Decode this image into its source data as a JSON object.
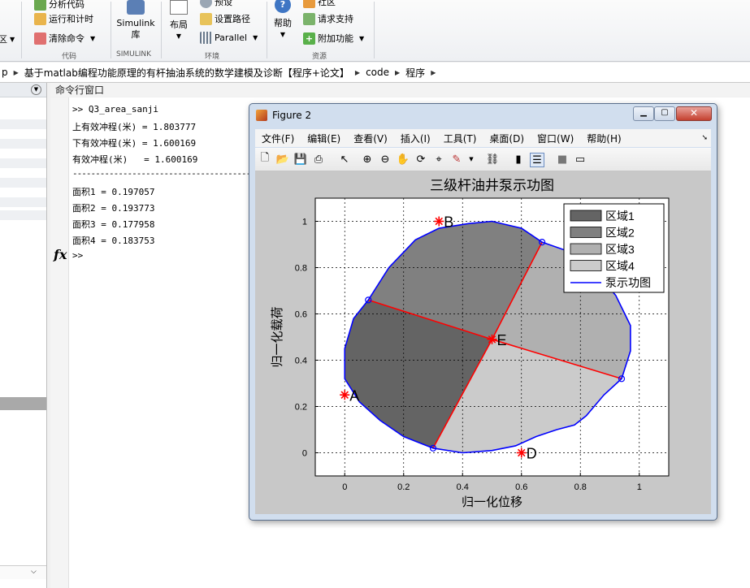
{
  "ribbon": {
    "code_group": {
      "label": "代码",
      "items": [
        "分析代码",
        "运行和计时",
        "清除命令"
      ]
    },
    "left_cut_label": "区",
    "simulink_group": {
      "label": "SIMULINK",
      "button": [
        "Simulink",
        "库"
      ]
    },
    "env_group": {
      "label": "环境",
      "layout_button": "布局",
      "items": [
        "预设",
        "设置路径",
        "Parallel"
      ]
    },
    "resource_group": {
      "label": "资源",
      "help_button": "帮助",
      "items": [
        "社区",
        "请求支持",
        "附加功能"
      ]
    }
  },
  "address": {
    "crumbs": [
      "p",
      "基于matlab编程功能原理的有杆抽油系统的数学建模及诊断【程序+论文】",
      "code",
      "程序"
    ]
  },
  "command_window": {
    "title": "命令行窗口",
    "lines": [
      ">> Q3_area_sanji",
      "上有效冲程(米) = 1.803777",
      "下有效冲程(米) = 1.600169",
      "有效冲程(米)   = 1.600169",
      "------------------------------------------------",
      "面积1 = 0.197057",
      "面积2 = 0.193773",
      "面积3 = 0.177958",
      "面积4 = 0.183753",
      ">>"
    ],
    "fx_label": "fx"
  },
  "figure": {
    "title": "Figure 2",
    "menu": [
      "文件(F)",
      "编辑(E)",
      "查看(V)",
      "插入(I)",
      "工具(T)",
      "桌面(D)",
      "窗口(W)",
      "帮助(H)"
    ]
  },
  "chart_data": {
    "type": "area",
    "title": "三级杆油井泵示功图",
    "xlabel": "归一化位移",
    "ylabel": "归一化载荷",
    "xlim": [
      -0.1,
      1.1
    ],
    "ylim": [
      -0.1,
      1.1
    ],
    "xticks": [
      "0",
      "0.2",
      "0.4",
      "0.6",
      "0.8",
      "1"
    ],
    "yticks": [
      "0",
      "0.2",
      "0.4",
      "0.6",
      "0.8",
      "1"
    ],
    "grid": true,
    "legend_position": "top-right",
    "legend": [
      "区域1",
      "区域2",
      "区域3",
      "区域4",
      "泵示功图"
    ],
    "colors": {
      "region1": "#646464",
      "region2": "#808080",
      "region3": "#b0b0b0",
      "region4": "#cbcbcb",
      "curve": "#0000ff",
      "line": "#ff0000",
      "marker": "#ff0000"
    },
    "center": [
      0.5,
      0.49
    ],
    "circle_points": [
      [
        0.08,
        0.66
      ],
      [
        0.67,
        0.91
      ],
      [
        0.94,
        0.32
      ],
      [
        0.3,
        0.02
      ]
    ],
    "regions": [
      {
        "name": "区域1",
        "points": [
          [
            0.5,
            0.49
          ],
          [
            0.08,
            0.66
          ],
          [
            0.03,
            0.58
          ],
          [
            0.0,
            0.45
          ],
          [
            0.0,
            0.32
          ],
          [
            0.05,
            0.22
          ],
          [
            0.12,
            0.14
          ],
          [
            0.2,
            0.07
          ],
          [
            0.3,
            0.02
          ]
        ]
      },
      {
        "name": "区域2",
        "points": [
          [
            0.5,
            0.49
          ],
          [
            0.08,
            0.66
          ],
          [
            0.15,
            0.8
          ],
          [
            0.24,
            0.92
          ],
          [
            0.32,
            0.97
          ],
          [
            0.42,
            0.99
          ],
          [
            0.5,
            1.0
          ],
          [
            0.6,
            0.97
          ],
          [
            0.67,
            0.91
          ]
        ]
      },
      {
        "name": "区域3",
        "points": [
          [
            0.5,
            0.49
          ],
          [
            0.67,
            0.91
          ],
          [
            0.76,
            0.87
          ],
          [
            0.84,
            0.8
          ],
          [
            0.92,
            0.68
          ],
          [
            0.97,
            0.55
          ],
          [
            0.97,
            0.44
          ],
          [
            0.94,
            0.32
          ]
        ]
      },
      {
        "name": "区域4",
        "points": [
          [
            0.5,
            0.49
          ],
          [
            0.94,
            0.32
          ],
          [
            0.88,
            0.25
          ],
          [
            0.82,
            0.16
          ],
          [
            0.78,
            0.12
          ],
          [
            0.72,
            0.1
          ],
          [
            0.65,
            0.07
          ],
          [
            0.58,
            0.03
          ],
          [
            0.5,
            0.01
          ],
          [
            0.4,
            0.0
          ],
          [
            0.3,
            0.02
          ]
        ]
      }
    ],
    "curve": [
      [
        0.08,
        0.66
      ],
      [
        0.15,
        0.8
      ],
      [
        0.24,
        0.92
      ],
      [
        0.32,
        0.97
      ],
      [
        0.42,
        0.99
      ],
      [
        0.5,
        1.0
      ],
      [
        0.6,
        0.97
      ],
      [
        0.67,
        0.91
      ],
      [
        0.76,
        0.87
      ],
      [
        0.84,
        0.8
      ],
      [
        0.92,
        0.68
      ],
      [
        0.97,
        0.55
      ],
      [
        0.97,
        0.44
      ],
      [
        0.94,
        0.32
      ],
      [
        0.88,
        0.25
      ],
      [
        0.82,
        0.16
      ],
      [
        0.78,
        0.12
      ],
      [
        0.72,
        0.1
      ],
      [
        0.65,
        0.07
      ],
      [
        0.58,
        0.03
      ],
      [
        0.5,
        0.01
      ],
      [
        0.4,
        0.0
      ],
      [
        0.3,
        0.02
      ],
      [
        0.2,
        0.07
      ],
      [
        0.12,
        0.14
      ],
      [
        0.05,
        0.22
      ],
      [
        0.0,
        0.32
      ],
      [
        0.0,
        0.45
      ],
      [
        0.03,
        0.58
      ],
      [
        0.08,
        0.66
      ]
    ],
    "annotations": [
      {
        "label": "A",
        "x": 0.0,
        "y": 0.25
      },
      {
        "label": "B",
        "x": 0.32,
        "y": 1.0
      },
      {
        "label": "D",
        "x": 0.6,
        "y": 0.0
      },
      {
        "label": "E",
        "x": 0.5,
        "y": 0.49
      }
    ]
  }
}
